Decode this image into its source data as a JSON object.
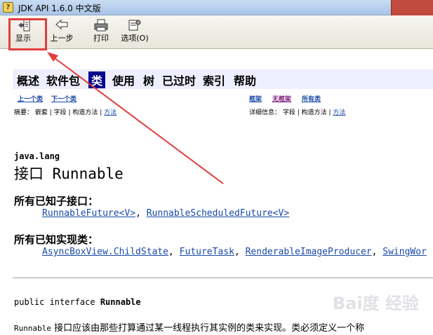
{
  "window": {
    "title": "JDK API 1.6.0 中文版"
  },
  "toolbar": {
    "show_label": "显示",
    "back_label": "上一步",
    "print_label": "打印",
    "options_label": "选项(O)"
  },
  "nav": {
    "items": [
      "概述",
      "软件包",
      "类",
      "使用",
      "树",
      "已过时",
      "索引",
      "帮助"
    ],
    "prev_class": "上一个类",
    "next_class": "下一个类",
    "frames": "框架",
    "no_frames": "无框架",
    "all_classes": "所有类",
    "summary_label": "摘要：",
    "summary_items": "嵌套 | 字段 | 构造方法 |",
    "summary_method": "方法",
    "detail_label": "详细信息：",
    "detail_items": "字段 | 构造方法 |",
    "detail_method": "方法"
  },
  "doc": {
    "package": "java.lang",
    "title": "接口 Runnable",
    "subinterfaces_head": "所有已知子接口：",
    "subinterfaces": [
      "RunnableFuture<V>",
      "RunnableScheduledFuture<V>"
    ],
    "impl_head": "所有已知实现类：",
    "impl_classes": [
      "AsyncBoxView.ChildState",
      "FutureTask",
      "RenderableImageProducer",
      "SwingWor"
    ],
    "declaration_prefix": "public interface ",
    "declaration_name": "Runnable",
    "desc_code": "Runnable",
    "desc_text": " 接口应该由那些打算通过某一线程执行其实例的类来实现。类必须定义一个称"
  },
  "watermark": "Bai度 经验",
  "colors": {
    "highlight": "#e33d3d",
    "link": "#1a4aaa",
    "nav_bg": "#eeeeff",
    "nav_active": "#00008b"
  }
}
